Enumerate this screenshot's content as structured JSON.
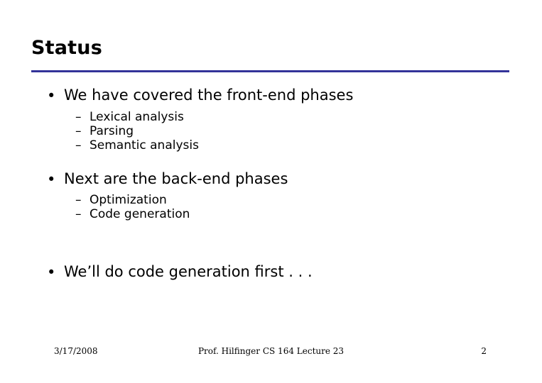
{
  "slide": {
    "title": "Status",
    "accent_color": "#333399",
    "bullets": [
      {
        "level1": "We have covered the front-end phases",
        "marker": "•",
        "children": [
          {
            "marker": "–",
            "text": "Lexical analysis"
          },
          {
            "marker": "–",
            "text": "Parsing"
          },
          {
            "marker": "–",
            "text": "Semantic analysis"
          }
        ]
      },
      {
        "level1": "Next are the back-end phases",
        "marker": "•",
        "children": [
          {
            "marker": "–",
            "text": "Optimization"
          },
          {
            "marker": "–",
            "text": "Code generation"
          }
        ]
      },
      {
        "level1": "We’ll do code generation first . . .",
        "marker": "•",
        "children": []
      }
    ],
    "footer": {
      "date": "3/17/2008",
      "center": "Prof. Hilfinger CS 164 Lecture 23",
      "page": "2"
    }
  }
}
